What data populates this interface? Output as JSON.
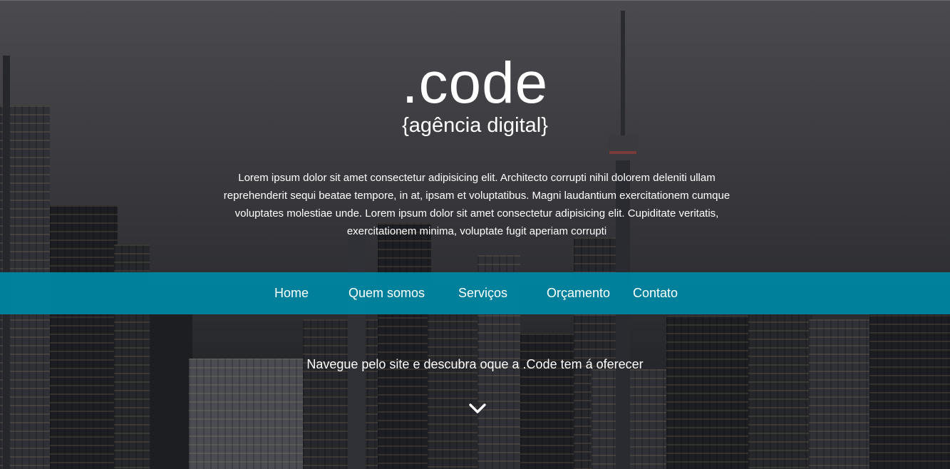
{
  "hero": {
    "brand": ".code",
    "tagline": "{agência digital}",
    "intro": "Lorem ipsum dolor sit amet consectetur adipisicing elit. Architecto corrupti nihil dolorem deleniti ullam reprehenderit sequi beatae tempore, in at, ipsam et voluptatibus. Magni laudantium exercitationem cumque voluptates molestiae unde. Lorem ipsum dolor sit amet consectetur adipisicing elit. Cupiditate veritatis, exercitationem minima, voluptate fugit aperiam corrupti"
  },
  "nav": {
    "items": [
      {
        "label": "Home"
      },
      {
        "label": "Quem somos"
      },
      {
        "label": "Serviços"
      },
      {
        "label": "Orçamento"
      },
      {
        "label": "Contato"
      }
    ]
  },
  "cta": {
    "text": "Navegue pelo site e descubra oque a .Code tem á oferecer",
    "icon": "chevron-down-icon"
  },
  "colors": {
    "nav_background": "#0084a0",
    "text": "#ffffff"
  }
}
